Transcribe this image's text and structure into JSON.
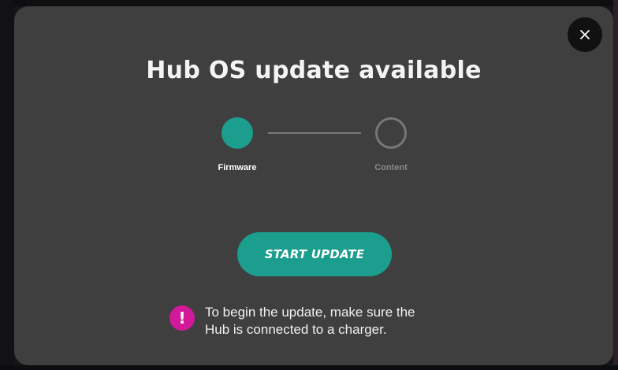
{
  "modal": {
    "title": "Hub OS update available",
    "close_icon": "close-icon"
  },
  "stepper": {
    "steps": [
      {
        "label": "Firmware",
        "state": "active"
      },
      {
        "label": "Content",
        "state": "inactive"
      }
    ]
  },
  "actions": {
    "start_label": "START UPDATE"
  },
  "notice": {
    "icon": "exclamation-icon",
    "text_line1": "To begin the update, make sure the",
    "text_line2": "Hub is connected to a charger."
  },
  "colors": {
    "accent": "#1b9e8e",
    "warning": "#d1199a",
    "modal_bg": "#3f3f3f"
  }
}
